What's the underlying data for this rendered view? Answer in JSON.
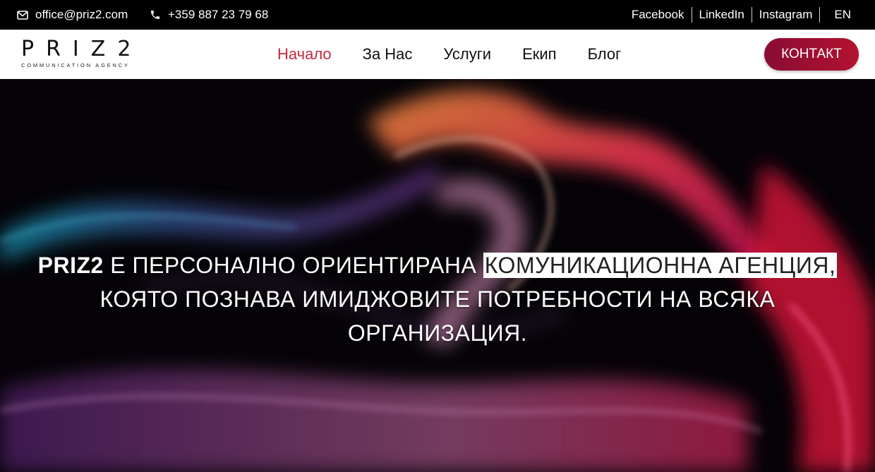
{
  "topbar": {
    "email": "office@priz2.com",
    "phone": "+359 887 23 79 68",
    "social": [
      "Facebook",
      "LinkedIn",
      "Instagram"
    ],
    "lang": "EN"
  },
  "header": {
    "logo_word": "PRIZ2",
    "logo_sub": "COMMUNICATION AGENCY",
    "nav": [
      "Начало",
      "За Нас",
      "Услуги",
      "Екип",
      "Блог"
    ],
    "active_index": 0,
    "cta": "КОНТАКТ",
    "accent_color": "#c7283a",
    "cta_color": "#9e0f33"
  },
  "hero": {
    "brand": "PRIZ2",
    "text_before": " Е ПЕРСОНАЛНО ОРИЕНТИРАНА ",
    "highlight": "КОМУНИКАЦИОННА АГЕНЦИЯ,",
    "line2": "КОЯТО ПОЗНАВА ИМИДЖОВИТЕ ПОТРЕБНОСТИ НА ВСЯКА",
    "line3": "ОРГАНИЗАЦИЯ."
  }
}
